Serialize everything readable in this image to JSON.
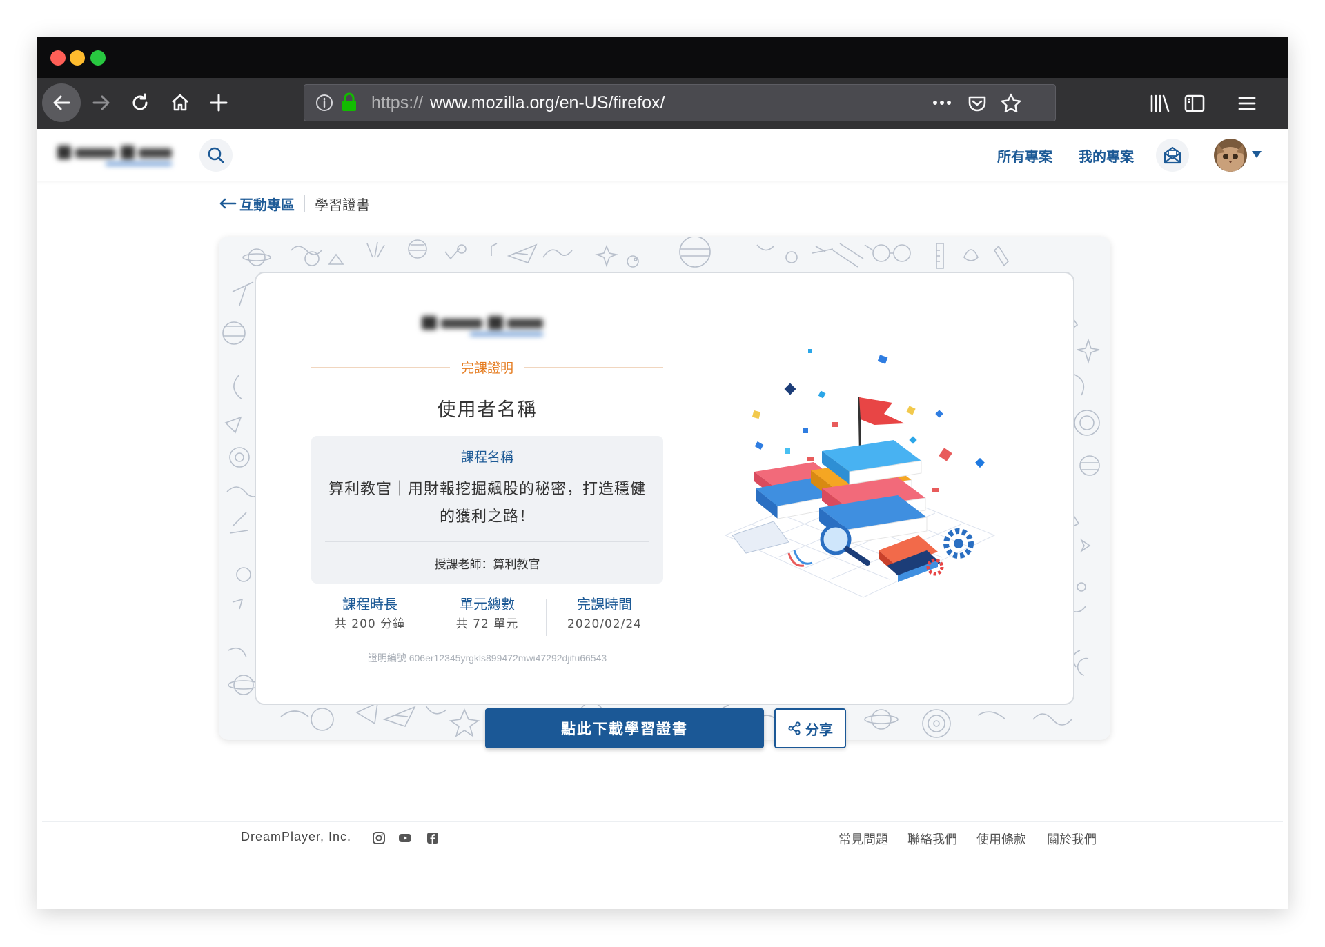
{
  "browser": {
    "url_protocol": "https://",
    "url_host_path": "www.mozilla.org/en-US/firefox/"
  },
  "site": {
    "nav_all_projects": "所有專案",
    "nav_my_projects": "我的專案"
  },
  "breadcrumb": {
    "back": "互動專區",
    "current": "學習證書"
  },
  "certificate": {
    "label": "完課證明",
    "user_name": "使用者名稱",
    "course_label": "課程名稱",
    "course_title": "算利教官｜用財報挖掘飆股的秘密，打造穩健的獲利之路！",
    "teacher": "授課老師：算利教官",
    "stats": [
      {
        "label": "課程時長",
        "value": "共 200 分鐘"
      },
      {
        "label": "單元總數",
        "value": "共 72 單元"
      },
      {
        "label": "完課時間",
        "value": "2020/02/24"
      }
    ],
    "cert_no": "證明編號 606er12345yrgkls899472mwi47292djifu66543"
  },
  "actions": {
    "download": "點此下載學習證書",
    "share": "分享"
  },
  "footer": {
    "company": "DreamPlayer, Inc.",
    "links": [
      "常見問題",
      "聯絡我們",
      "使用條款",
      "關於我們"
    ]
  },
  "colors": {
    "brand_blue": "#1b5896",
    "accent_orange": "#e57b1f",
    "close": "#ff5f57",
    "minimize": "#febc2e",
    "maximize": "#28c840"
  }
}
